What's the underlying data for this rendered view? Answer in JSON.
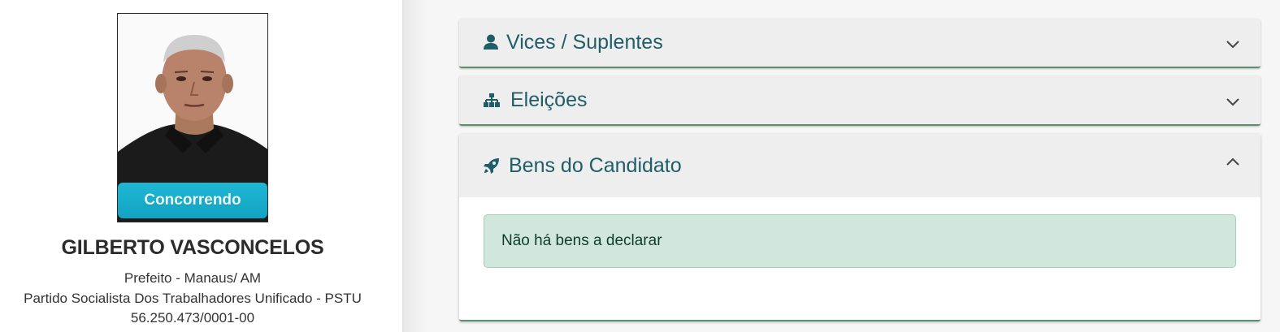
{
  "candidate": {
    "status_badge": "Concorrendo",
    "name": "GILBERTO VASCONCELOS",
    "office": "Prefeito - Manaus/ AM",
    "party": "Partido Socialista Dos Trabalhadores Unificado - PSTU",
    "cnpj": "56.250.473/0001-00"
  },
  "sections": [
    {
      "title": "Vices / Suplentes",
      "icon": "user-icon",
      "expanded": false
    },
    {
      "title": "Eleições",
      "icon": "sitemap-icon",
      "expanded": false
    },
    {
      "title": "Bens do Candidato",
      "icon": "rocket-icon",
      "expanded": true
    }
  ],
  "bens": {
    "message": "Não há bens a declarar"
  },
  "colors": {
    "accent": "#1f5d68",
    "badge": "#12a3c2",
    "alert_bg": "#d1e7dd",
    "border_green": "#5b8f6d"
  }
}
